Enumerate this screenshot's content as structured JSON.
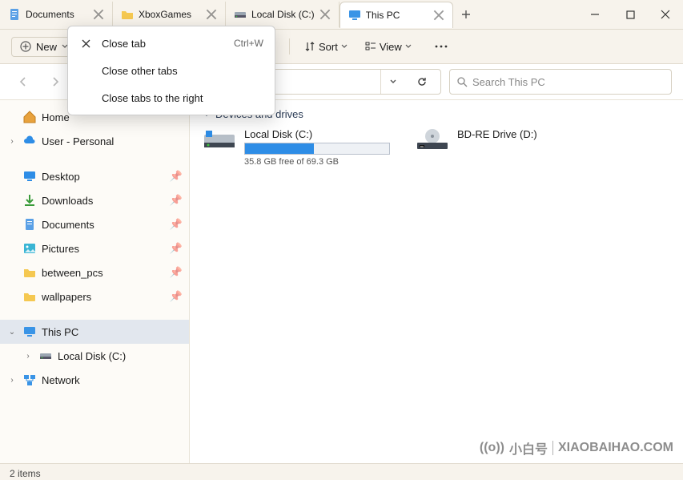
{
  "tabs": [
    {
      "label": "Documents",
      "icon": "doc"
    },
    {
      "label": "XboxGames",
      "icon": "folder"
    },
    {
      "label": "Local Disk (C:)",
      "icon": "disk"
    },
    {
      "label": "This PC",
      "icon": "pc",
      "active": true
    }
  ],
  "context_menu": {
    "items": [
      {
        "label": "Close tab",
        "shortcut": "Ctrl+W",
        "icon": "x"
      },
      {
        "label": "Close other tabs",
        "shortcut": "",
        "icon": ""
      },
      {
        "label": "Close tabs to the right",
        "shortcut": "",
        "icon": ""
      }
    ]
  },
  "toolbar": {
    "new_label": "New",
    "sort_label": "Sort",
    "view_label": "View"
  },
  "search": {
    "placeholder": "Search This PC"
  },
  "sidebar": {
    "home": "Home",
    "user": "User - Personal",
    "quick": [
      {
        "label": "Desktop",
        "icon": "desktop"
      },
      {
        "label": "Downloads",
        "icon": "downloads"
      },
      {
        "label": "Documents",
        "icon": "doc"
      },
      {
        "label": "Pictures",
        "icon": "pictures"
      },
      {
        "label": "between_pcs",
        "icon": "folder"
      },
      {
        "label": "wallpapers",
        "icon": "folder"
      }
    ],
    "thispc": "This PC",
    "localdisk": "Local Disk (C:)",
    "network": "Network"
  },
  "content": {
    "group": "Devices and drives",
    "drives": [
      {
        "name": "Local Disk (C:)",
        "free_text": "35.8 GB free of 69.3 GB",
        "fill_pct": 48
      },
      {
        "name": "BD-RE Drive (D:)"
      }
    ]
  },
  "status": {
    "text": "2 items"
  },
  "watermark": {
    "cn": "小白号",
    "en": "XIAOBAIHAO.COM"
  }
}
